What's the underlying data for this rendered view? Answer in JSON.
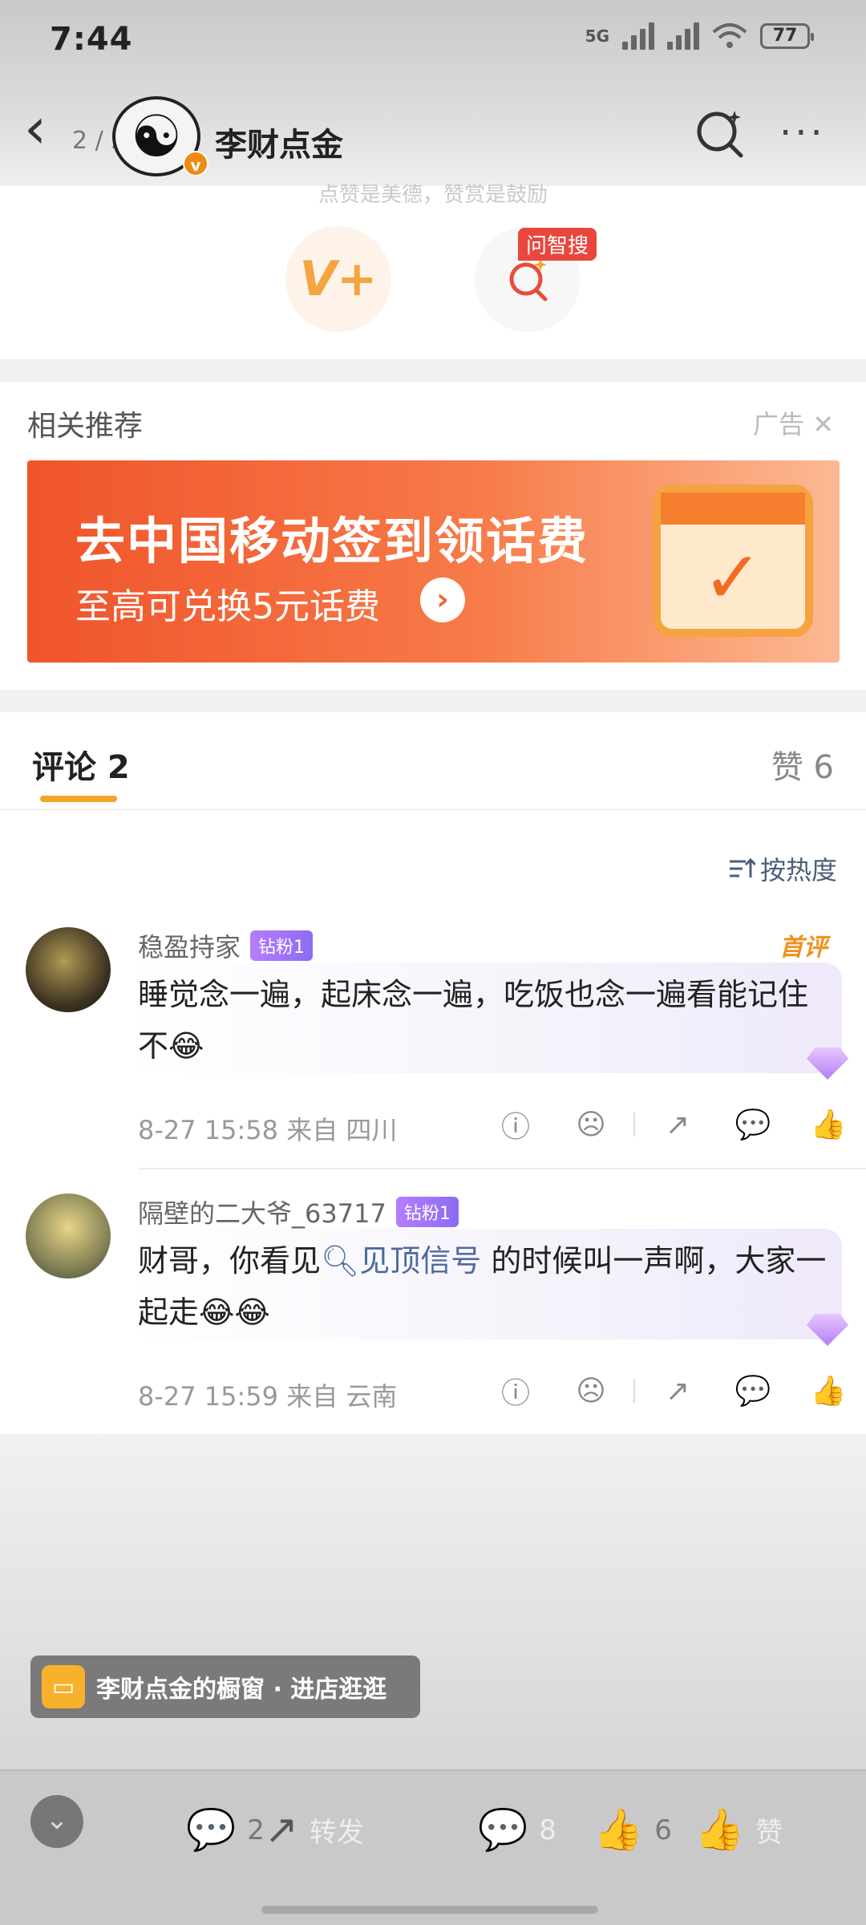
{
  "status_bar": {
    "time": "7:44",
    "network": "5G",
    "battery": "77"
  },
  "nav": {
    "page_counter": "2 / 2",
    "title": "李财点金",
    "verified_badge": "v"
  },
  "actions": {
    "hint": "点赞是美德，赞赏是鼓励",
    "v_label": "V+",
    "ask_badge": "问智搜"
  },
  "recommend": {
    "title": "相关推荐",
    "ad_label": "广告",
    "banner_headline": "去中国移动签到领话费",
    "banner_sub": "至高可兑换5元话费"
  },
  "comments_section": {
    "tab_label": "评论 2",
    "likes_label": "赞 6",
    "sort_label": "按热度",
    "comments": [
      {
        "username": "稳盈持家",
        "fan_badge": "钻粉1",
        "first_badge": "首评",
        "text": "睡觉念一遍，起床念一遍，吃饭也念一遍看能记住不😂",
        "meta": "8-27 15:58  来自 四川"
      },
      {
        "username": "隔壁的二大爷_63717",
        "fan_badge": "钻粉1",
        "text_before": "财哥，你看见",
        "link_text": "见顶信号",
        "text_after": " 的时候叫一声啊，大家一起走😂😂",
        "meta": "8-27 15:59  来自 云南"
      }
    ]
  },
  "shop": {
    "label": "李财点金的橱窗 · 进店逛逛"
  },
  "bottom_bar": {
    "comment_count": "2",
    "repost_label": "转发",
    "repost_count": "8",
    "like_count": "6",
    "like_label": "赞"
  }
}
